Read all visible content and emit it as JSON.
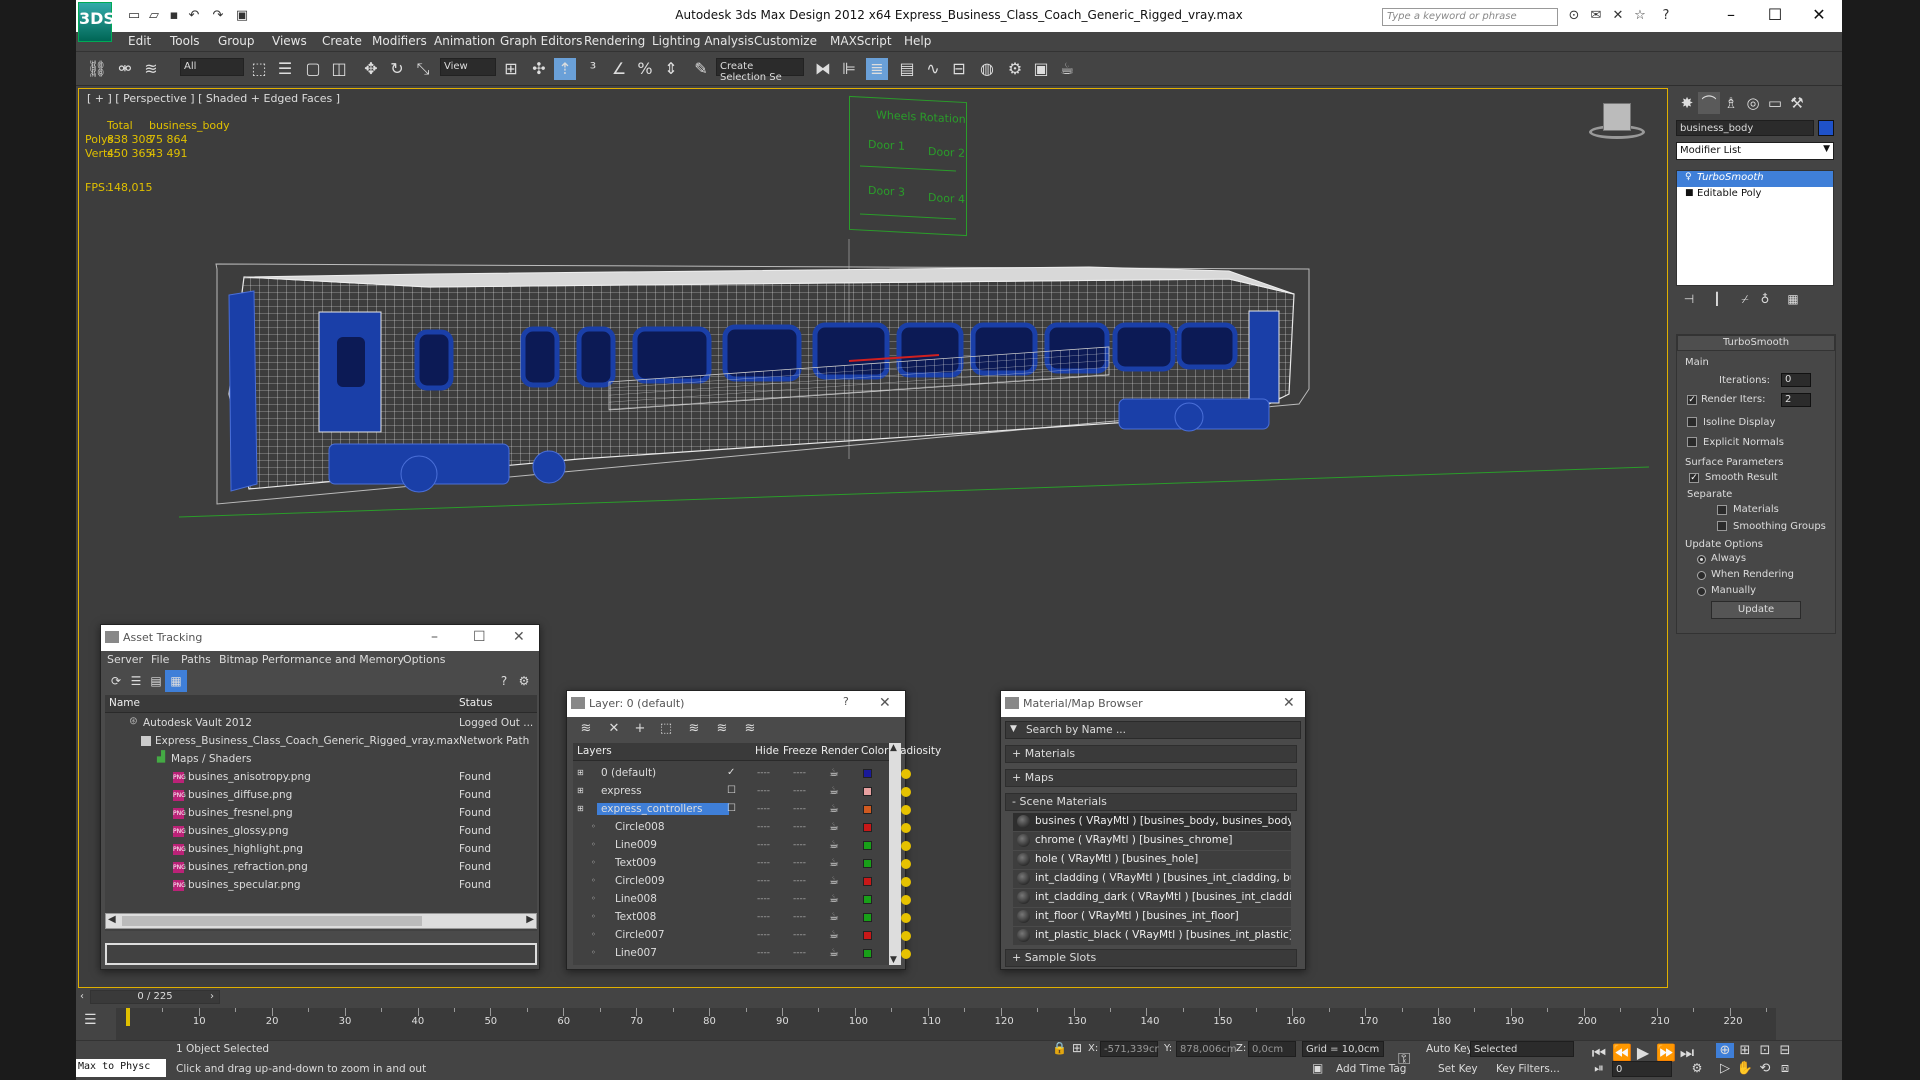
{
  "app": {
    "title": "Autodesk 3ds Max Design 2012 x64      Express_Business_Class_Coach_Generic_Rigged_vray.max",
    "logo_text": "3DS",
    "search_placeholder": "Type a keyword or phrase"
  },
  "menu": [
    "Edit",
    "Tools",
    "Group",
    "Views",
    "Create",
    "Modifiers",
    "Animation",
    "Graph Editors",
    "Rendering",
    "Lighting Analysis",
    "Customize",
    "MAXScript",
    "Help"
  ],
  "toolbar": {
    "filter_value": "All",
    "view_value": "View",
    "selection_set_placeholder": "Create Selection Se"
  },
  "viewport": {
    "label": "[ + ] [ Perspective ] [ Shaded + Edged Faces ]",
    "stats": {
      "total_label": "Total",
      "object_label": "business_body",
      "polys_label": "Polys:",
      "polys_total": "838 308",
      "polys_obj": "75 864",
      "verts_label": "Verts:",
      "verts_total": "450 365",
      "verts_obj": "43 491",
      "fps_label": "FPS:",
      "fps_value": "148,015"
    },
    "controller_panel": {
      "title": "Wheels Rotation",
      "door1": "Door 1",
      "door2": "Door 2",
      "door3": "Door 3",
      "door4": "Door 4"
    },
    "colors": {
      "wire": "#e8e8e8",
      "body_blue": "#1a3fa8",
      "window": "#0c1a55",
      "green": "#2a9d2a"
    }
  },
  "command_panel": {
    "object_name": "business_body",
    "object_color": "#1f52c9",
    "modifier_list_label": "Modifier List",
    "stack": [
      "TurboSmooth",
      "Editable Poly"
    ],
    "rollout_title": "TurboSmooth",
    "main_label": "Main",
    "iterations_label": "Iterations:",
    "iterations_value": "0",
    "render_iters_label": "Render Iters:",
    "render_iters_value": "2",
    "isoline_label": "Isoline Display",
    "explicit_label": "Explicit Normals",
    "surface_label": "Surface Parameters",
    "smooth_result_label": "Smooth Result",
    "separate_label": "Separate",
    "materials_label": "Materials",
    "smoothing_groups_label": "Smoothing Groups",
    "update_options_label": "Update Options",
    "always_label": "Always",
    "when_rendering_label": "When Rendering",
    "manually_label": "Manually",
    "update_button": "Update"
  },
  "asset_tracking": {
    "title": "Asset Tracking",
    "menu": [
      "Server",
      "File",
      "Paths",
      "Bitmap Performance and Memory",
      "Options"
    ],
    "col_name": "Name",
    "col_status": "Status",
    "rows": [
      {
        "name": "Autodesk Vault 2012",
        "status": "Logged Out ..."
      },
      {
        "name": "Express_Business_Class_Coach_Generic_Rigged_vray.max",
        "status": "Network Path"
      },
      {
        "name": "Maps / Shaders",
        "status": ""
      },
      {
        "name": "busines_anisotropy.png",
        "status": "Found"
      },
      {
        "name": "busines_diffuse.png",
        "status": "Found"
      },
      {
        "name": "busines_fresnel.png",
        "status": "Found"
      },
      {
        "name": "busines_glossy.png",
        "status": "Found"
      },
      {
        "name": "busines_highlight.png",
        "status": "Found"
      },
      {
        "name": "busines_refraction.png",
        "status": "Found"
      },
      {
        "name": "busines_specular.png",
        "status": "Found"
      }
    ]
  },
  "layer_dialog": {
    "title": "Layer: 0 (default)",
    "help": "?",
    "cols": [
      "Layers",
      "Hide",
      "Freeze",
      "Render",
      "Color",
      "Radiosity"
    ],
    "rows": [
      {
        "name": "0 (default)",
        "color": "#1a1a9a"
      },
      {
        "name": "express",
        "color": "#e8a0a0"
      },
      {
        "name": "express_controllers",
        "color": "#d05a20"
      },
      {
        "name": "Circle008",
        "color": "#c81818"
      },
      {
        "name": "Line009",
        "color": "#18a018"
      },
      {
        "name": "Text009",
        "color": "#18a018"
      },
      {
        "name": "Circle009",
        "color": "#c81818"
      },
      {
        "name": "Line008",
        "color": "#18a018"
      },
      {
        "name": "Text008",
        "color": "#18a018"
      },
      {
        "name": "Circle007",
        "color": "#c81818"
      },
      {
        "name": "Line007",
        "color": "#18a018"
      }
    ]
  },
  "material_browser": {
    "title": "Material/Map Browser",
    "search_placeholder": "Search by Name ...",
    "sections": {
      "materials": "+ Materials",
      "maps": "+ Maps",
      "scene": "- Scene Materials",
      "slots": "+ Sample Slots"
    },
    "materials": [
      "busines  ( VRayMtl ) [busines_body, busines_body...",
      "chrome  ( VRayMtl ) [busines_chrome]",
      "hole  ( VRayMtl ) [busines_hole]",
      "int_cladding  ( VRayMtl ) [busines_int_cladding, bu...",
      "int_cladding_dark  ( VRayMtl ) [busines_int_claddi...",
      "int_floor  ( VRayMtl ) [busines_int_floor]",
      "int_plastic_black  ( VRayMtl ) [busines_int_plastic]"
    ]
  },
  "timeline": {
    "frame_label": "0 / 225",
    "ticks": [
      "10",
      "20",
      "30",
      "40",
      "50",
      "60",
      "70",
      "80",
      "90",
      "100",
      "110",
      "120",
      "130",
      "140",
      "150",
      "160",
      "170",
      "180",
      "190",
      "200",
      "210",
      "220"
    ]
  },
  "status": {
    "maxscript": "Max to Physc",
    "selected": "1 Object Selected",
    "prompt": "Click and drag up-and-down to zoom in and out",
    "x_label": "X:",
    "x_value": "-571,339cr",
    "y_label": "Y:",
    "y_value": "878,006cm",
    "z_label": "Z:",
    "z_value": "0,0cm",
    "grid": "Grid = 10,0cm",
    "auto_key": "Auto Key",
    "selected_dropdown": "Selected",
    "set_key": "Set Key",
    "key_filters": "Key Filters...",
    "add_time_tag": "Add Time Tag",
    "frame_value": "0"
  }
}
